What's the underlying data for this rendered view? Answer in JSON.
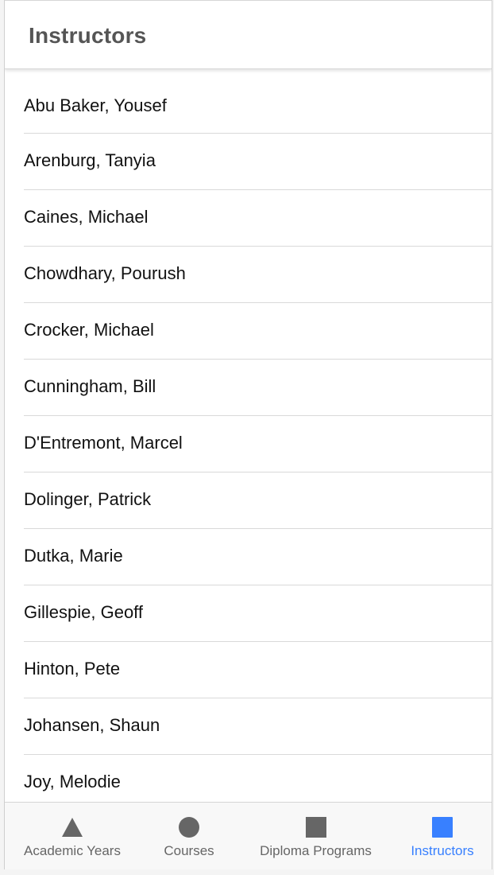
{
  "header": {
    "title": "Instructors"
  },
  "instructors": [
    "Abu Baker, Yousef",
    "Arenburg, Tanyia",
    "Caines, Michael",
    "Chowdhary, Pourush",
    "Crocker, Michael",
    "Cunningham, Bill",
    "D'Entremont, Marcel",
    "Dolinger, Patrick",
    "Dutka, Marie",
    "Gillespie, Geoff",
    "Hinton, Pete",
    "Johansen, Shaun",
    "Joy, Melodie"
  ],
  "tabs": [
    {
      "label": "Academic Years",
      "icon": "triangle-icon",
      "active": false
    },
    {
      "label": "Courses",
      "icon": "circle-icon",
      "active": false
    },
    {
      "label": "Diploma Programs",
      "icon": "square-icon",
      "active": false
    },
    {
      "label": "Instructors",
      "icon": "square-icon",
      "active": true
    }
  ],
  "colors": {
    "active_tab": "#3880ff",
    "inactive_icon": "#666666",
    "title_text": "#555555"
  }
}
